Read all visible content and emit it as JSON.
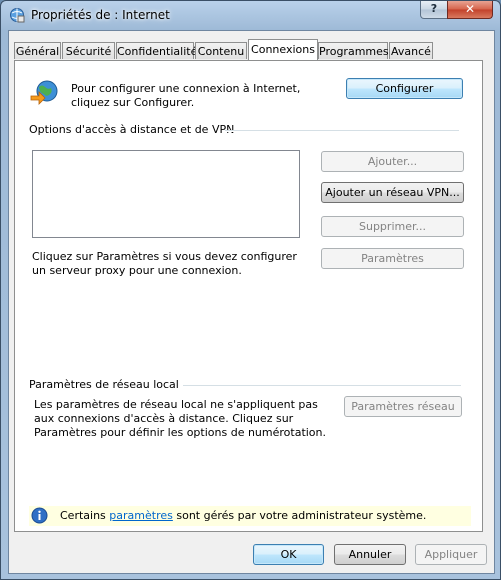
{
  "window": {
    "title": "Propriétés de : Internet",
    "help_button": "?",
    "close_button": "✕"
  },
  "tabs": [
    {
      "label": "Général",
      "active": false
    },
    {
      "label": "Sécurité",
      "active": false
    },
    {
      "label": "Confidentialité",
      "active": false
    },
    {
      "label": "Contenu",
      "active": false
    },
    {
      "label": "Connexions",
      "active": true
    },
    {
      "label": "Programmes",
      "active": false
    },
    {
      "label": "Avancé",
      "active": false
    }
  ],
  "setup": {
    "text": "Pour configurer une connexion à Internet, cliquez sur Configurer.",
    "button": "Configurer"
  },
  "dialup": {
    "group_title": "Options d'accès à distance et de VPN",
    "add_button": "Ajouter...",
    "add_vpn_button": "Ajouter un réseau VPN...",
    "remove_button": "Supprimer...",
    "settings_button": "Paramètres",
    "hint": "Cliquez sur Paramètres si vous devez configurer un serveur proxy pour une connexion."
  },
  "lan": {
    "group_title": "Paramètres de réseau local",
    "text": "Les paramètres de réseau local ne s'appliquent pas aux connexions d'accès à distance. Cliquez sur Paramètres pour définir les options de numérotation.",
    "button": "Paramètres réseau"
  },
  "info": {
    "prefix": "Certains",
    "link": "paramètres",
    "suffix": "sont gérés par votre administrateur système."
  },
  "footer": {
    "ok": "OK",
    "cancel": "Annuler",
    "apply": "Appliquer"
  },
  "colors": {
    "accent": "#3c7fb1",
    "link": "#0066cc",
    "info_background": "#ffffe1"
  }
}
